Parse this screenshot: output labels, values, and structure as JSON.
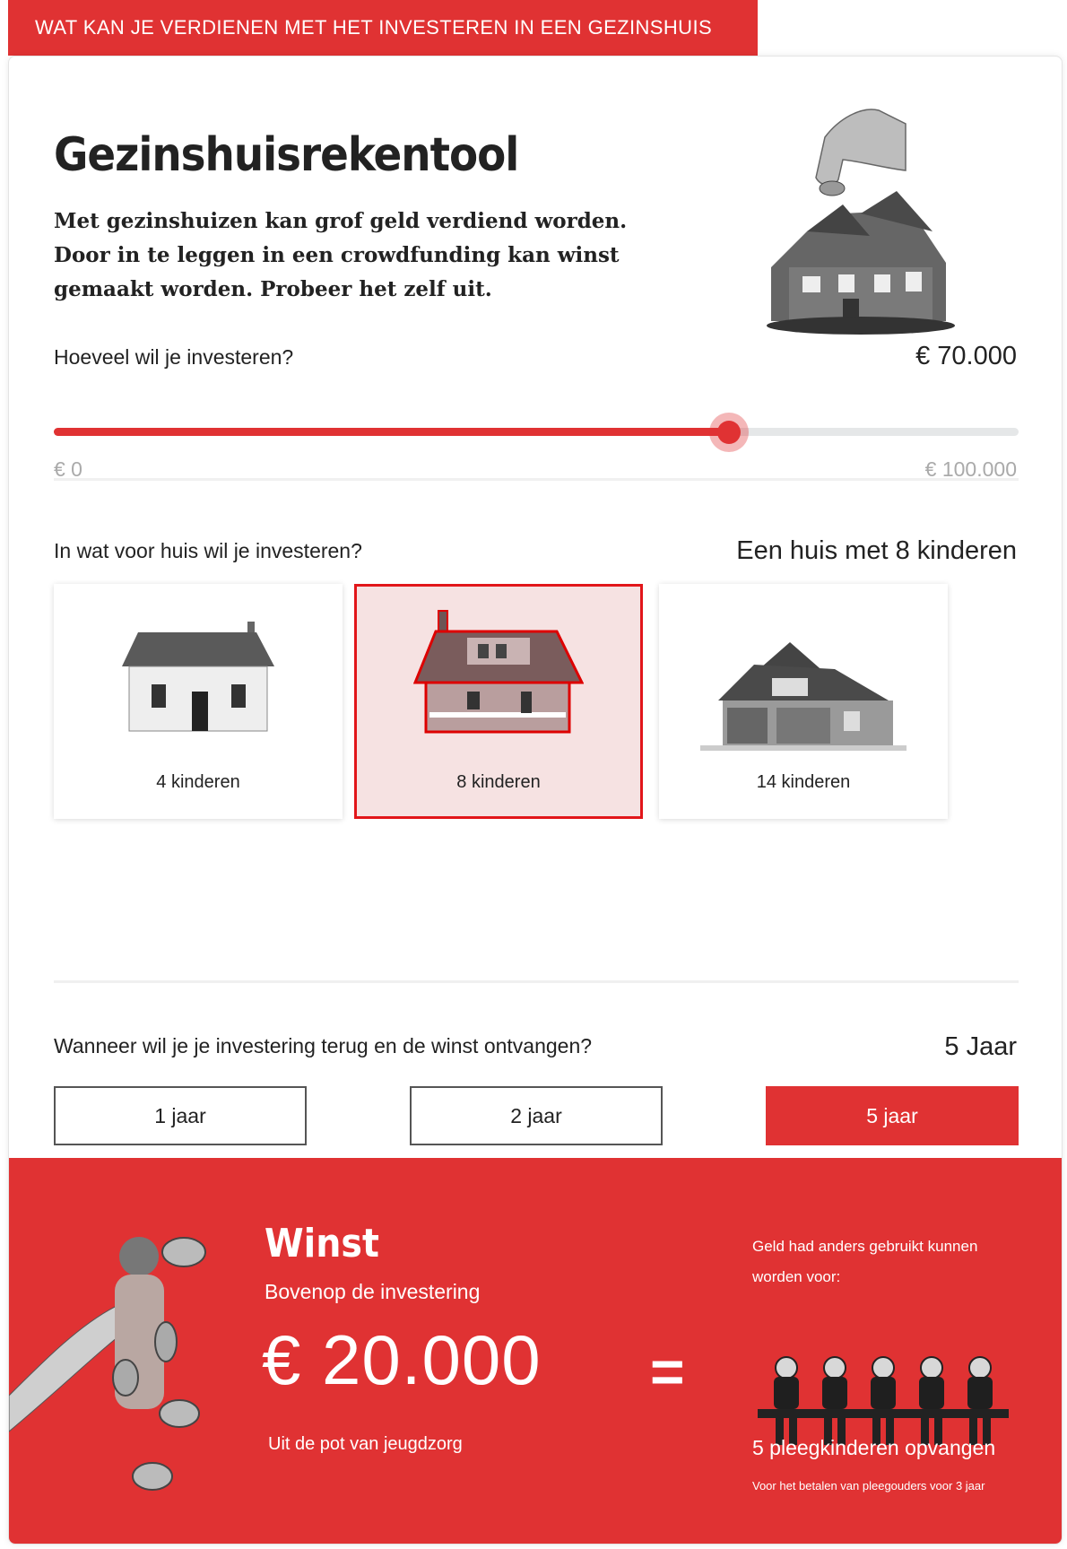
{
  "banner": {
    "text": "WAT KAN JE VERDIENEN MET HET INVESTEREN IN EEN GEZINSHUIS"
  },
  "header": {
    "title": "Gezinshuisrekentool",
    "intro": "Met gezinshuizen kan grof geld verdiend worden. Door in te leggen in een crowdfunding kan winst gemaakt worden. Probeer het zelf uit."
  },
  "investment": {
    "question": "Hoeveel wil je investeren?",
    "value_label": "€ 70.000",
    "min_label": "€ 0",
    "max_label": "€ 100.000",
    "fraction": 0.7
  },
  "house": {
    "question": "In wat voor huis wil je investeren?",
    "selected_label": "Een huis met 8 kinderen",
    "options": [
      {
        "label": "4 kinderen",
        "selected": false
      },
      {
        "label": "8 kinderen",
        "selected": true
      },
      {
        "label": "14 kinderen",
        "selected": false
      }
    ]
  },
  "term": {
    "question": "Wanneer wil je je investering terug en de winst ontvangen?",
    "selected_label": "5 Jaar",
    "options": [
      {
        "label": "1 jaar",
        "active": false
      },
      {
        "label": "2 jaar",
        "active": false
      },
      {
        "label": "5 jaar",
        "active": true
      }
    ]
  },
  "result": {
    "title": "Winst",
    "subtitle": "Bovenop de investering",
    "amount": "€ 20.000",
    "source_note": "Uit de pot van jeugdzorg",
    "equals": "=",
    "alt_heading": "Geld had anders gebruikt kunnen worden voor:",
    "alt_main": "5 pleegkinderen opvangen",
    "alt_note": "Voor het betalen van pleegouders voor 3 jaar",
    "kids_count": 5
  },
  "colors": {
    "accent": "#e03233",
    "selected_bg": "#f6e2e2",
    "track": "#e5e7e8"
  }
}
